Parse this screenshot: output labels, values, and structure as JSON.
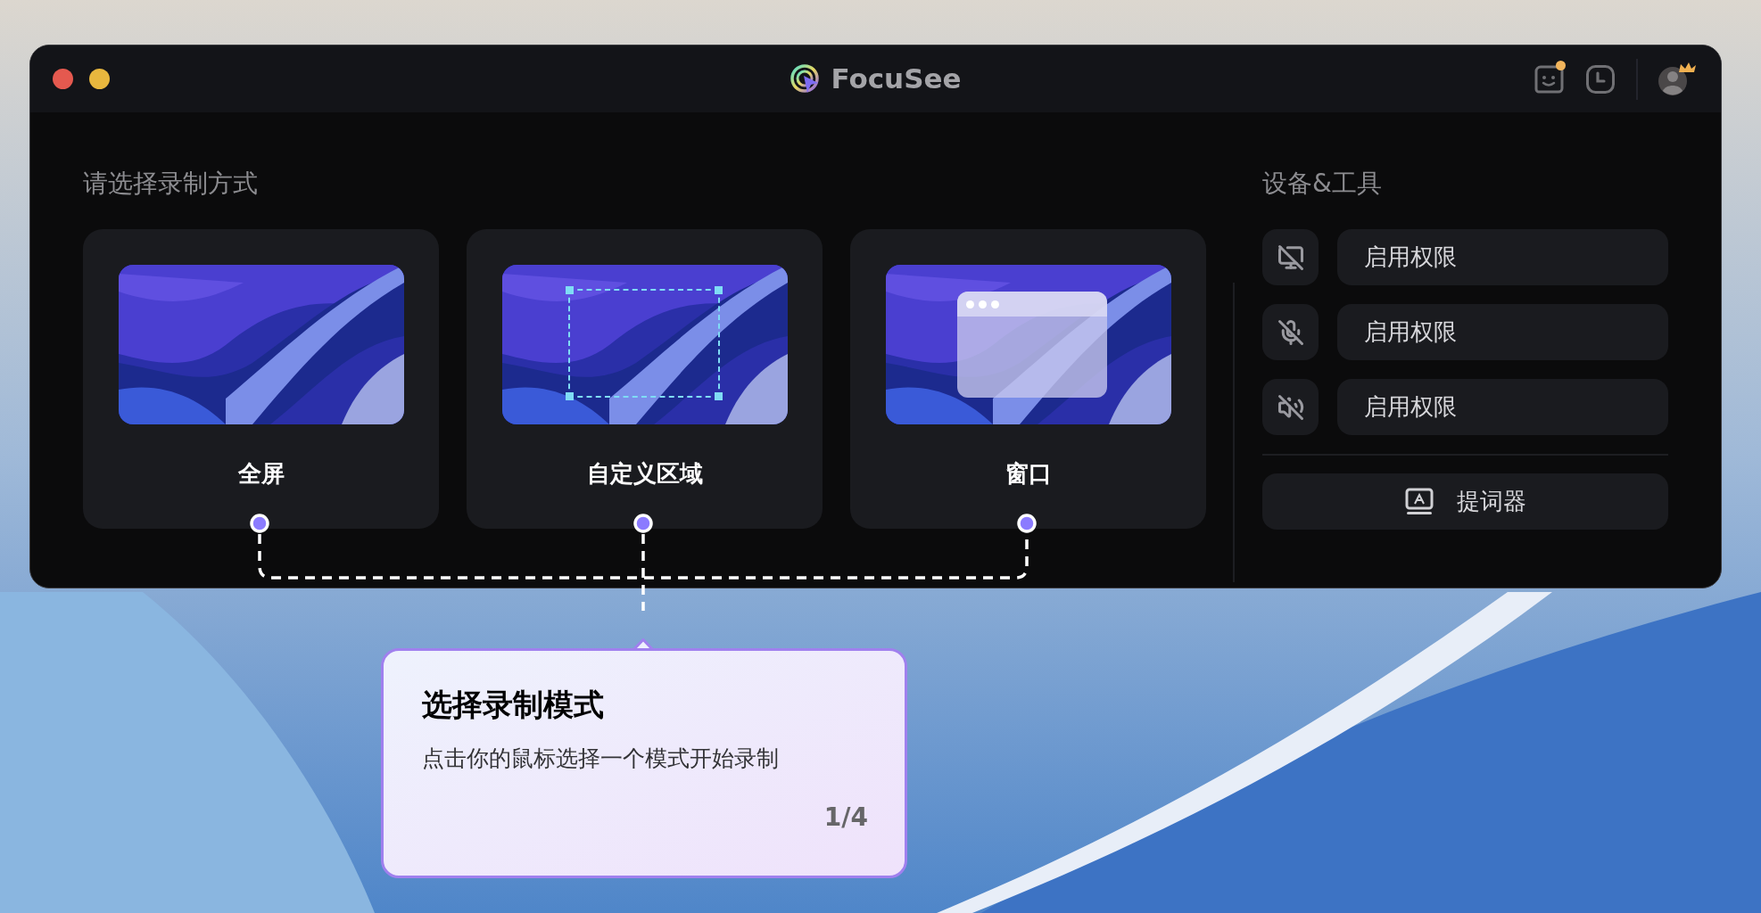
{
  "window": {
    "title": "FocuSee",
    "feedback_badge": true
  },
  "modes": {
    "heading": "请选择录制方式",
    "items": [
      {
        "kind": "fullscreen",
        "label": "全屏"
      },
      {
        "kind": "region",
        "label": "自定义区域"
      },
      {
        "kind": "window",
        "label": "窗口"
      }
    ]
  },
  "devices": {
    "heading": "设备&工具",
    "items": [
      {
        "kind": "screen",
        "label": "启用权限"
      },
      {
        "kind": "microphone",
        "label": "启用权限"
      },
      {
        "kind": "speaker",
        "label": "启用权限"
      }
    ],
    "teleprompter": "提词器"
  },
  "tooltip": {
    "title": "选择录制模式",
    "body": "点击你的鼠标选择一个模式开始录制",
    "step": "1/4"
  }
}
